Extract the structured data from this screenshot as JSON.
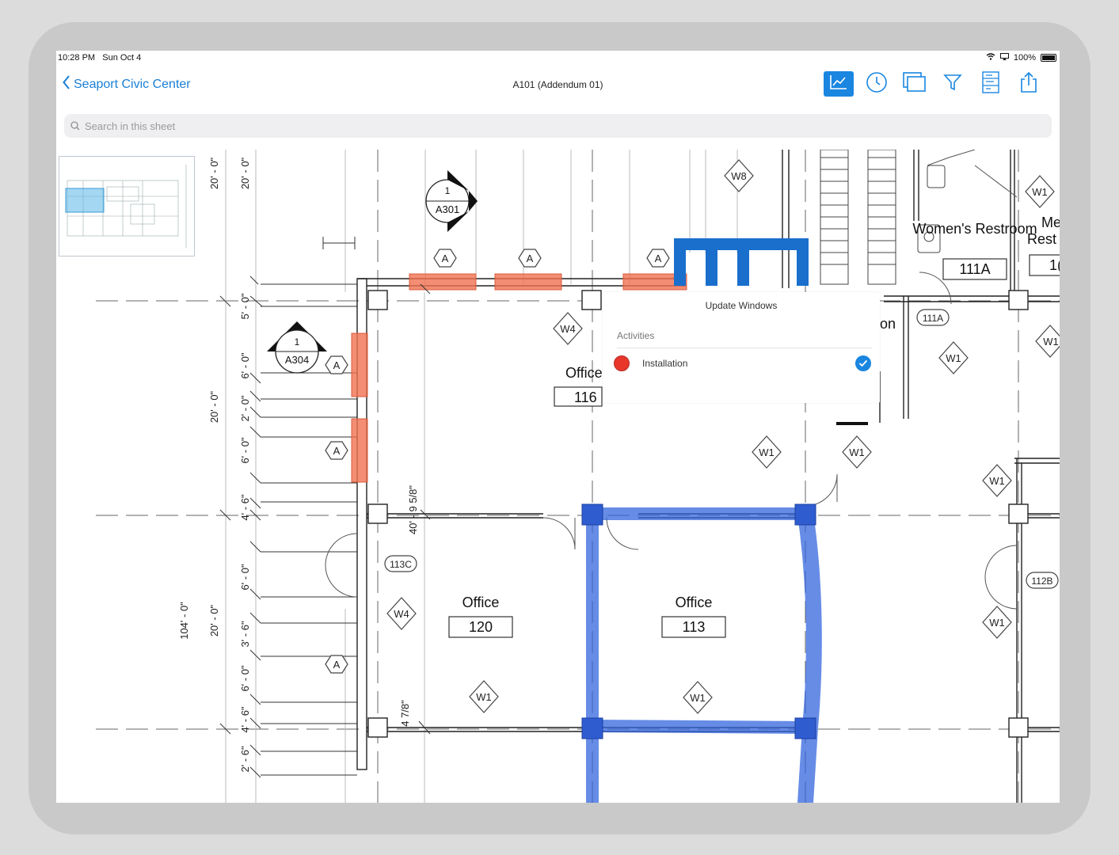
{
  "status_bar": {
    "time": "10:28 PM",
    "date": "Sun Oct 4",
    "battery": "100%"
  },
  "nav": {
    "back_label": "Seaport Civic Center",
    "sheet_title": "A101 (Addendum 01)"
  },
  "toolbar": {
    "tools": [
      "chart-icon",
      "clock-icon",
      "layers-icon",
      "filter-icon",
      "sheet-list-icon",
      "share-icon"
    ],
    "active_tool": "chart-icon",
    "accent": "#1a86e0"
  },
  "search": {
    "placeholder": "Search in this sheet"
  },
  "popup": {
    "title": "Update Windows",
    "section_label": "Activities",
    "activity": {
      "label": "Installation",
      "status_color": "#e8362b",
      "checked": true
    }
  },
  "drawing": {
    "section_markers": [
      {
        "num": "1",
        "sheet": "A301"
      },
      {
        "num": "1",
        "sheet": "A304"
      }
    ],
    "rooms": [
      {
        "name": "Office",
        "number": "116"
      },
      {
        "name": "Office",
        "number": "120"
      },
      {
        "name": "Office",
        "number": "113"
      },
      {
        "name": "Women's Restroom",
        "number": "111A"
      }
    ],
    "partial_labels": [
      "Me",
      "Rest",
      "1(",
      "on"
    ],
    "door_tags": [
      "113C",
      "111A",
      "112B"
    ],
    "window_tags": [
      "W8",
      "W4",
      "W4",
      "W1",
      "W1",
      "W1",
      "W1",
      "W1",
      "W1",
      "W1",
      "W1",
      "W1"
    ],
    "wall_tags": [
      "A",
      "A",
      "A",
      "A",
      "A",
      "A"
    ],
    "dimensions_outer": [
      "20' - 0\"",
      "20' - 0\"",
      "20' - 0\"",
      "104' - 0\""
    ],
    "dimensions_inner": [
      "20' - 0\"",
      "5' - 0\"",
      "6' - 0\"",
      "2' - 0\"",
      "6' - 0\"",
      "4' - 6\"",
      "6' - 0\"",
      "3' - 6\"",
      "6' - 0\"",
      "4' - 6\"",
      "2' - 6\""
    ],
    "dimensions_vertical": [
      "40' - 9 5/8\"",
      "4 7/8\""
    ],
    "highlight_colors": {
      "selected_walls": "#3366dd",
      "windows": "#f07050"
    }
  }
}
